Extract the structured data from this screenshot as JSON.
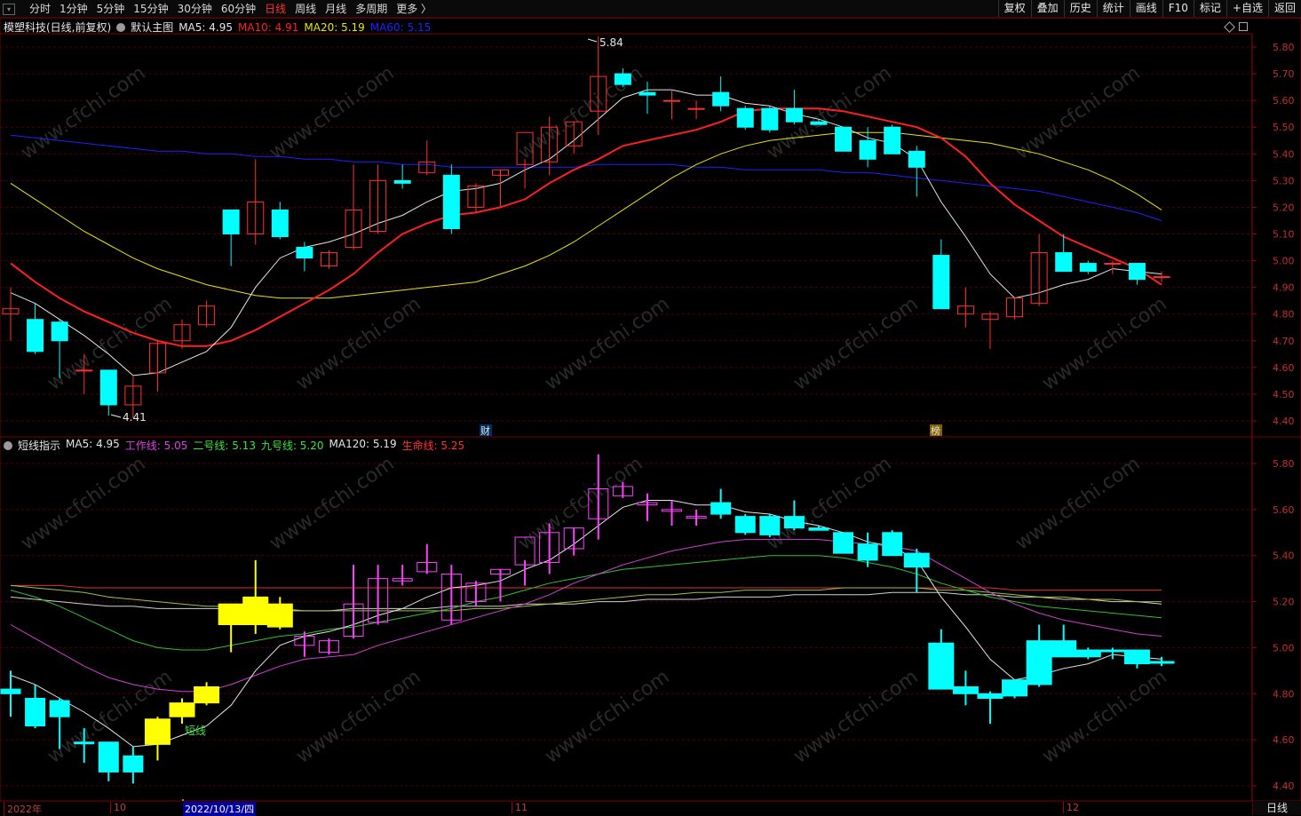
{
  "toolbar": {
    "tabs": [
      {
        "label": "分时",
        "active": false
      },
      {
        "label": "1分钟",
        "active": false
      },
      {
        "label": "5分钟",
        "active": false
      },
      {
        "label": "15分钟",
        "active": false
      },
      {
        "label": "30分钟",
        "active": false
      },
      {
        "label": "60分钟",
        "active": false
      },
      {
        "label": "日线",
        "active": true
      },
      {
        "label": "周线",
        "active": false
      },
      {
        "label": "月线",
        "active": false
      },
      {
        "label": "多周期",
        "active": false
      },
      {
        "label": "更多 〉",
        "active": false
      }
    ],
    "right_buttons": [
      "复权",
      "叠加",
      "历史",
      "统计",
      "画线",
      "F10",
      "标记",
      "+自选",
      "返回"
    ]
  },
  "main_panel": {
    "stock": "模塑科技(日线,前复权)",
    "indicator": "默认主图",
    "ma_items": [
      {
        "label": "MA5: 4.95",
        "color": "#e6e6e6"
      },
      {
        "label": "MA10: 4.91",
        "color": "#ff2020"
      },
      {
        "label": "MA20: 5.19",
        "color": "#e6e600"
      },
      {
        "label": "MA60: 5.15",
        "color": "#2020ff"
      }
    ],
    "y_ticks": [
      "5.80",
      "5.70",
      "5.60",
      "5.50",
      "5.40",
      "5.30",
      "5.20",
      "5.10",
      "5.00",
      "4.90",
      "4.80",
      "4.70",
      "4.60",
      "4.50",
      "4.40"
    ],
    "high_label": "5.84",
    "low_label": "4.41",
    "marker_cai": "财",
    "marker_bang": "榜"
  },
  "sub_panel": {
    "name": "短线指示",
    "items": [
      {
        "label": "MA5: 4.95",
        "color": "#e6e6e6"
      },
      {
        "label": "工作线: 5.05",
        "color": "#e040e0"
      },
      {
        "label": "二号线: 5.13",
        "color": "#40e040"
      },
      {
        "label": "九号线: 5.20",
        "color": "#40e040"
      },
      {
        "label": "MA120: 5.19",
        "color": "#e6e6e6"
      },
      {
        "label": "生命线: 5.25",
        "color": "#ff3030"
      }
    ],
    "y_ticks": [
      "5.80",
      "5.60",
      "5.40",
      "5.20",
      "5.00",
      "4.80",
      "4.60",
      "4.40"
    ],
    "annotation": "短线"
  },
  "date_axis": {
    "labels": [
      "2022年",
      "10",
      "2022/10/13/四",
      "11",
      "12"
    ],
    "period": "日线"
  },
  "colors": {
    "up": "#ff3030",
    "down": "#00ffff",
    "pink": "#ff40ff",
    "yellow": "#ffff00",
    "ma5": "#e6e6e6",
    "ma10": "#ff2020",
    "ma20": "#e6e600",
    "ma60": "#2020ff"
  },
  "chart_data": {
    "type": "candlestick",
    "candles": [
      {
        "o": 4.8,
        "h": 4.9,
        "l": 4.7,
        "c": 4.82
      },
      {
        "o": 4.78,
        "h": 4.84,
        "l": 4.65,
        "c": 4.66
      },
      {
        "o": 4.77,
        "h": 4.78,
        "l": 4.56,
        "c": 4.7
      },
      {
        "o": 4.59,
        "h": 4.65,
        "l": 4.5,
        "c": 4.59
      },
      {
        "o": 4.59,
        "h": 4.59,
        "l": 4.42,
        "c": 4.46
      },
      {
        "o": 4.46,
        "h": 4.57,
        "l": 4.41,
        "c": 4.53
      },
      {
        "o": 4.58,
        "h": 4.7,
        "l": 4.51,
        "c": 4.69
      },
      {
        "o": 4.7,
        "h": 4.78,
        "l": 4.67,
        "c": 4.76
      },
      {
        "o": 4.76,
        "h": 4.85,
        "l": 4.75,
        "c": 4.83
      },
      {
        "o": 5.19,
        "h": 5.19,
        "l": 4.98,
        "c": 5.1
      },
      {
        "o": 5.1,
        "h": 5.38,
        "l": 5.06,
        "c": 5.22
      },
      {
        "o": 5.19,
        "h": 5.22,
        "l": 5.08,
        "c": 5.09
      },
      {
        "o": 5.05,
        "h": 5.07,
        "l": 4.96,
        "c": 5.01
      },
      {
        "o": 4.98,
        "h": 5.04,
        "l": 4.97,
        "c": 5.03
      },
      {
        "o": 5.05,
        "h": 5.36,
        "l": 5.04,
        "c": 5.19
      },
      {
        "o": 5.11,
        "h": 5.36,
        "l": 5.1,
        "c": 5.3
      },
      {
        "o": 5.3,
        "h": 5.36,
        "l": 5.27,
        "c": 5.29
      },
      {
        "o": 5.33,
        "h": 5.45,
        "l": 5.32,
        "c": 5.37
      },
      {
        "o": 5.32,
        "h": 5.36,
        "l": 5.1,
        "c": 5.12
      },
      {
        "o": 5.2,
        "h": 5.29,
        "l": 5.18,
        "c": 5.28
      },
      {
        "o": 5.32,
        "h": 5.34,
        "l": 5.2,
        "c": 5.34
      },
      {
        "o": 5.36,
        "h": 5.38,
        "l": 5.27,
        "c": 5.48
      },
      {
        "o": 5.37,
        "h": 5.54,
        "l": 5.32,
        "c": 5.5
      },
      {
        "o": 5.43,
        "h": 5.52,
        "l": 5.4,
        "c": 5.52
      },
      {
        "o": 5.56,
        "h": 5.84,
        "l": 5.47,
        "c": 5.69
      },
      {
        "o": 5.7,
        "h": 5.72,
        "l": 5.65,
        "c": 5.66
      },
      {
        "o": 5.63,
        "h": 5.67,
        "l": 5.55,
        "c": 5.62
      },
      {
        "o": 5.6,
        "h": 5.64,
        "l": 5.53,
        "c": 5.6
      },
      {
        "o": 5.57,
        "h": 5.6,
        "l": 5.53,
        "c": 5.57
      },
      {
        "o": 5.63,
        "h": 5.69,
        "l": 5.56,
        "c": 5.58
      },
      {
        "o": 5.57,
        "h": 5.58,
        "l": 5.49,
        "c": 5.5
      },
      {
        "o": 5.57,
        "h": 5.58,
        "l": 5.48,
        "c": 5.49
      },
      {
        "o": 5.57,
        "h": 5.64,
        "l": 5.51,
        "c": 5.52
      },
      {
        "o": 5.52,
        "h": 5.53,
        "l": 5.51,
        "c": 5.51
      },
      {
        "o": 5.5,
        "h": 5.5,
        "l": 5.41,
        "c": 5.41
      },
      {
        "o": 5.45,
        "h": 5.5,
        "l": 5.35,
        "c": 5.38
      },
      {
        "o": 5.5,
        "h": 5.51,
        "l": 5.4,
        "c": 5.4
      },
      {
        "o": 5.41,
        "h": 5.43,
        "l": 5.24,
        "c": 5.35
      },
      {
        "o": 5.02,
        "h": 5.08,
        "l": 4.82,
        "c": 4.82
      },
      {
        "o": 4.8,
        "h": 4.9,
        "l": 4.75,
        "c": 4.83
      },
      {
        "o": 4.78,
        "h": 4.81,
        "l": 4.67,
        "c": 4.8
      },
      {
        "o": 4.79,
        "h": 4.86,
        "l": 4.78,
        "c": 4.86
      },
      {
        "o": 4.84,
        "h": 5.1,
        "l": 4.83,
        "c": 5.03
      },
      {
        "o": 5.03,
        "h": 5.1,
        "l": 4.97,
        "c": 4.96
      },
      {
        "o": 4.99,
        "h": 5.0,
        "l": 4.95,
        "c": 4.96
      },
      {
        "o": 4.99,
        "h": 5.0,
        "l": 4.95,
        "c": 4.99
      },
      {
        "o": 4.99,
        "h": 4.99,
        "l": 4.91,
        "c": 4.93
      },
      {
        "o": 4.94,
        "h": 4.96,
        "l": 4.92,
        "c": 4.94
      }
    ],
    "ma5": [
      4.88,
      4.84,
      4.78,
      4.72,
      4.65,
      4.57,
      4.58,
      4.62,
      4.66,
      4.75,
      4.9,
      5.01,
      5.05,
      5.07,
      5.1,
      5.14,
      5.17,
      5.22,
      5.26,
      5.27,
      5.29,
      5.34,
      5.38,
      5.45,
      5.53,
      5.61,
      5.64,
      5.64,
      5.62,
      5.62,
      5.59,
      5.58,
      5.55,
      5.53,
      5.5,
      5.46,
      5.44,
      5.38,
      5.22,
      5.09,
      4.95,
      4.86,
      4.88,
      4.91,
      4.93,
      4.97,
      4.96,
      4.95
    ],
    "ma10": [
      4.99,
      4.92,
      4.86,
      4.81,
      4.77,
      4.73,
      4.7,
      4.68,
      4.68,
      4.7,
      4.74,
      4.79,
      4.84,
      4.89,
      4.95,
      5.03,
      5.1,
      5.14,
      5.17,
      5.18,
      5.2,
      5.23,
      5.29,
      5.34,
      5.38,
      5.43,
      5.45,
      5.47,
      5.49,
      5.52,
      5.56,
      5.57,
      5.57,
      5.57,
      5.56,
      5.54,
      5.52,
      5.5,
      5.46,
      5.39,
      5.29,
      5.21,
      5.15,
      5.09,
      5.05,
      5.01,
      4.97,
      4.91
    ],
    "ma20": [
      5.29,
      5.23,
      5.17,
      5.11,
      5.06,
      5.01,
      4.97,
      4.94,
      4.91,
      4.89,
      4.87,
      4.86,
      4.86,
      4.86,
      4.87,
      4.88,
      4.89,
      4.9,
      4.91,
      4.92,
      4.95,
      4.98,
      5.02,
      5.07,
      5.13,
      5.19,
      5.25,
      5.31,
      5.36,
      5.4,
      5.43,
      5.45,
      5.46,
      5.47,
      5.48,
      5.48,
      5.48,
      5.47,
      5.46,
      5.45,
      5.44,
      5.42,
      5.4,
      5.37,
      5.34,
      5.3,
      5.25,
      5.19
    ],
    "ma60": [
      5.47,
      5.46,
      5.45,
      5.44,
      5.43,
      5.42,
      5.41,
      5.41,
      5.4,
      5.4,
      5.39,
      5.39,
      5.38,
      5.38,
      5.37,
      5.37,
      5.36,
      5.36,
      5.35,
      5.35,
      5.35,
      5.35,
      5.35,
      5.35,
      5.36,
      5.36,
      5.36,
      5.36,
      5.35,
      5.35,
      5.34,
      5.34,
      5.34,
      5.34,
      5.33,
      5.33,
      5.32,
      5.31,
      5.3,
      5.29,
      5.28,
      5.27,
      5.26,
      5.24,
      5.22,
      5.2,
      5.18,
      5.15
    ],
    "sub_work_line": [
      5.1,
      5.04,
      4.98,
      4.92,
      4.87,
      4.84,
      4.82,
      4.81,
      4.81,
      4.84,
      4.88,
      4.92,
      4.95,
      4.96,
      4.97,
      5.01,
      5.04,
      5.07,
      5.1,
      5.13,
      5.16,
      5.19,
      5.23,
      5.28,
      5.32,
      5.36,
      5.39,
      5.42,
      5.44,
      5.46,
      5.47,
      5.47,
      5.47,
      5.47,
      5.46,
      5.45,
      5.44,
      5.42,
      5.36,
      5.3,
      5.24,
      5.19,
      5.15,
      5.12,
      5.1,
      5.08,
      5.06,
      5.05
    ],
    "sub_line2": [
      5.25,
      5.22,
      5.18,
      5.13,
      5.08,
      5.03,
      5.0,
      4.99,
      4.99,
      5.01,
      5.03,
      5.05,
      5.06,
      5.08,
      5.09,
      5.11,
      5.13,
      5.15,
      5.17,
      5.2,
      5.22,
      5.25,
      5.28,
      5.3,
      5.32,
      5.34,
      5.35,
      5.36,
      5.37,
      5.38,
      5.39,
      5.4,
      5.4,
      5.4,
      5.39,
      5.37,
      5.35,
      5.32,
      5.28,
      5.25,
      5.22,
      5.2,
      5.18,
      5.17,
      5.16,
      5.15,
      5.14,
      5.13
    ],
    "sub_line9": [
      5.27,
      5.26,
      5.25,
      5.24,
      5.22,
      5.21,
      5.2,
      5.19,
      5.18,
      5.18,
      5.17,
      5.17,
      5.16,
      5.16,
      5.16,
      5.16,
      5.16,
      5.16,
      5.16,
      5.17,
      5.17,
      5.18,
      5.19,
      5.2,
      5.21,
      5.22,
      5.23,
      5.23,
      5.24,
      5.24,
      5.25,
      5.25,
      5.25,
      5.25,
      5.26,
      5.26,
      5.26,
      5.26,
      5.25,
      5.25,
      5.24,
      5.23,
      5.22,
      5.22,
      5.21,
      5.21,
      5.2,
      5.2
    ],
    "sub_ma120": [
      5.22,
      5.21,
      5.2,
      5.19,
      5.18,
      5.18,
      5.17,
      5.17,
      5.17,
      5.17,
      5.16,
      5.16,
      5.16,
      5.16,
      5.17,
      5.17,
      5.17,
      5.17,
      5.18,
      5.18,
      5.18,
      5.19,
      5.19,
      5.19,
      5.2,
      5.2,
      5.21,
      5.21,
      5.21,
      5.22,
      5.22,
      5.22,
      5.23,
      5.23,
      5.23,
      5.23,
      5.24,
      5.24,
      5.24,
      5.23,
      5.23,
      5.22,
      5.22,
      5.21,
      5.21,
      5.2,
      5.2,
      5.19
    ],
    "sub_lifeline": [
      5.27,
      5.27,
      5.27,
      5.26,
      5.26,
      5.26,
      5.26,
      5.26,
      5.26,
      5.26,
      5.26,
      5.26,
      5.26,
      5.26,
      5.26,
      5.26,
      5.26,
      5.26,
      5.26,
      5.26,
      5.26,
      5.26,
      5.26,
      5.26,
      5.26,
      5.26,
      5.26,
      5.26,
      5.26,
      5.26,
      5.26,
      5.26,
      5.26,
      5.26,
      5.26,
      5.26,
      5.26,
      5.26,
      5.26,
      5.26,
      5.26,
      5.25,
      5.25,
      5.25,
      5.25,
      5.25,
      5.25,
      5.25
    ],
    "main_ylim": [
      4.4,
      5.85
    ],
    "sub_ylim": [
      4.4,
      5.85
    ]
  }
}
